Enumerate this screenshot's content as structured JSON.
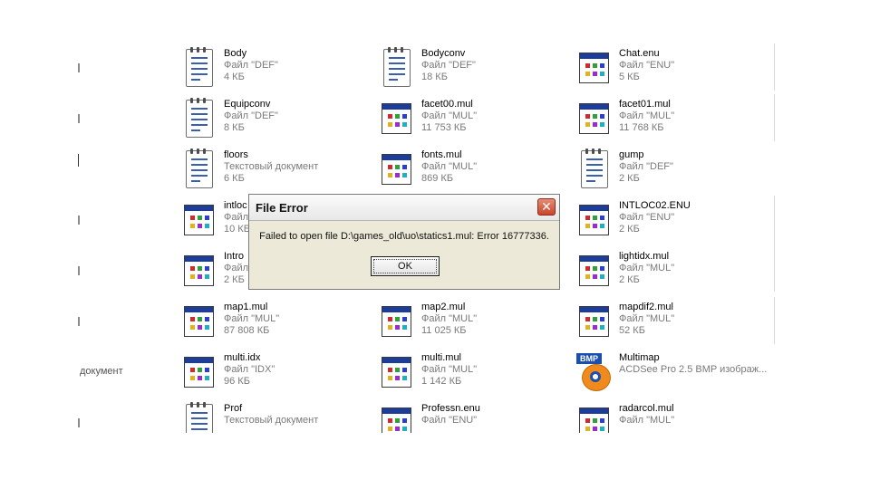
{
  "files": [
    {
      "name": "Body",
      "type": "Файл \"DEF\"",
      "size": "4 КБ",
      "icon": "text-doc-icon"
    },
    {
      "name": "Bodyconv",
      "type": "Файл \"DEF\"",
      "size": "18 КБ",
      "icon": "text-doc-icon"
    },
    {
      "name": "Chat.enu",
      "type": "Файл \"ENU\"",
      "size": "5 КБ",
      "icon": "system-file-icon"
    },
    {
      "name": "Equipconv",
      "type": "Файл \"DEF\"",
      "size": "8 КБ",
      "icon": "text-doc-icon"
    },
    {
      "name": "facet00.mul",
      "type": "Файл \"MUL\"",
      "size": "11 753 КБ",
      "icon": "system-file-icon"
    },
    {
      "name": "facet01.mul",
      "type": "Файл \"MUL\"",
      "size": "11 768 КБ",
      "icon": "system-file-icon"
    },
    {
      "name": "floors",
      "type": "Текстовый документ",
      "size": "6 КБ",
      "icon": "text-doc-icon"
    },
    {
      "name": "fonts.mul",
      "type": "Файл \"MUL\"",
      "size": "869 КБ",
      "icon": "system-file-icon"
    },
    {
      "name": "gump",
      "type": "Файл \"DEF\"",
      "size": "2 КБ",
      "icon": "text-doc-icon"
    },
    {
      "name": "intloc",
      "type": "Файл",
      "size": "10 КБ",
      "icon": "system-file-icon"
    },
    {
      "name": "",
      "type": "",
      "size": "",
      "icon": "none"
    },
    {
      "name": "INTLOC02.ENU",
      "type": "Файл \"ENU\"",
      "size": "2 КБ",
      "icon": "system-file-icon"
    },
    {
      "name": "Intro",
      "type": "Файл",
      "size": "2 КБ",
      "icon": "system-file-icon"
    },
    {
      "name": "",
      "type": "",
      "size": "",
      "icon": "none"
    },
    {
      "name": "lightidx.mul",
      "type": "Файл \"MUL\"",
      "size": "2 КБ",
      "icon": "system-file-icon"
    },
    {
      "name": "map1.mul",
      "type": "Файл \"MUL\"",
      "size": "87 808 КБ",
      "icon": "system-file-icon"
    },
    {
      "name": "map2.mul",
      "type": "Файл \"MUL\"",
      "size": "11 025 КБ",
      "icon": "system-file-icon"
    },
    {
      "name": "mapdif2.mul",
      "type": "Файл \"MUL\"",
      "size": "52 КБ",
      "icon": "system-file-icon"
    },
    {
      "name": "multi.idx",
      "type": "Файл \"IDX\"",
      "size": "96 КБ",
      "icon": "system-file-icon"
    },
    {
      "name": "multi.mul",
      "type": "Файл \"MUL\"",
      "size": "1 142 КБ",
      "icon": "system-file-icon"
    },
    {
      "name": "Multimap",
      "type": "ACDSee Pro 2.5 BMP изображ...",
      "size": "",
      "icon": "bmp-image-icon"
    },
    {
      "name": "Prof",
      "type": "Текстовый документ",
      "size": "",
      "icon": "text-doc-icon"
    },
    {
      "name": "Professn.enu",
      "type": "Файл \"ENU\"",
      "size": "",
      "icon": "system-file-icon"
    },
    {
      "name": "radarcol.mul",
      "type": "Файл \"MUL\"",
      "size": "",
      "icon": "system-file-icon"
    }
  ],
  "left_edge_text": "документ",
  "bmp_badge": "BMP",
  "dialog": {
    "title": "File Error",
    "close_glyph": "✕",
    "message": "Failed to open file D:\\games_old\\uo\\statics1.mul: Error 16777336.",
    "ok_label": "OK"
  }
}
